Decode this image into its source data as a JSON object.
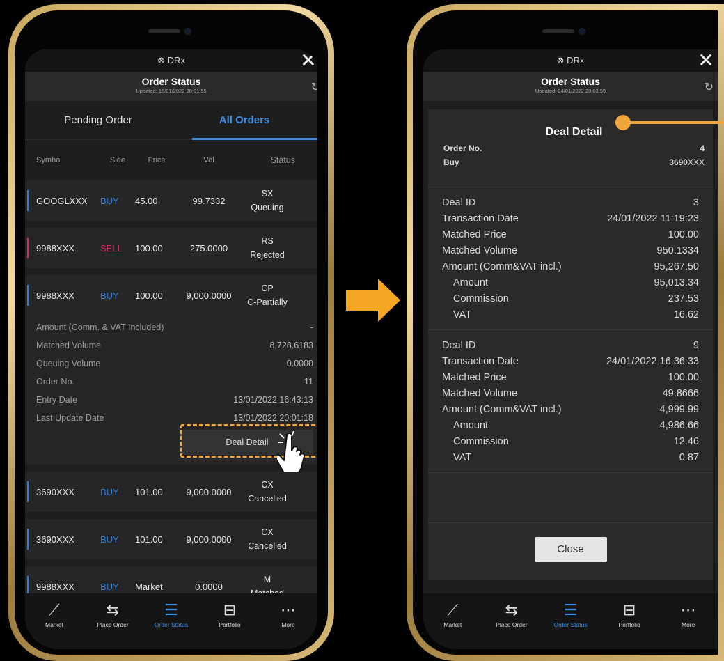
{
  "left": {
    "app_title": "DRx",
    "page_title": "Order Status",
    "updated": "Updated: 13/01/2022 20:01:55",
    "tabs": [
      "Pending Order",
      "All Orders"
    ],
    "columns": [
      "Symbol",
      "Side",
      "Price",
      "Vol",
      "Status"
    ],
    "rows": [
      {
        "symbol": "GOOGLXXX",
        "side": "BUY",
        "price": "45.00",
        "vol": "99.7332",
        "status_code": "SX",
        "status": "Queuing"
      },
      {
        "symbol": "9988XXX",
        "side": "SELL",
        "price": "100.00",
        "vol": "275.0000",
        "status_code": "RS",
        "status": "Rejected"
      },
      {
        "symbol": "9988XXX",
        "side": "BUY",
        "price": "100.00",
        "vol": "9,000.0000",
        "status_code": "CP",
        "status": "C-Partially"
      }
    ],
    "details": [
      {
        "k": "Amount (Comm. & VAT Included)",
        "v": "-"
      },
      {
        "k": "Matched Volume",
        "v": "8,728.6183"
      },
      {
        "k": "Queuing Volume",
        "v": "0.0000"
      },
      {
        "k": "Order No.",
        "v": "11"
      },
      {
        "k": "Entry Date",
        "v": "13/01/2022 16:43:13"
      },
      {
        "k": "Last Update Date",
        "v": "13/01/2022 20:01:18"
      }
    ],
    "deal_detail_btn": "Deal Detail",
    "rows2": [
      {
        "symbol": "3690XXX",
        "side": "BUY",
        "price": "101.00",
        "vol": "9,000.0000",
        "status_code": "CX",
        "status": "Cancelled"
      },
      {
        "symbol": "3690XXX",
        "side": "BUY",
        "price": "101.00",
        "vol": "9,000.0000",
        "status_code": "CX",
        "status": "Cancelled"
      },
      {
        "symbol": "9988XXX",
        "side": "BUY",
        "price": "Market",
        "vol": "0.0000",
        "status_code": "M",
        "status": "Matched"
      }
    ],
    "partial_row_code": "M",
    "nav": [
      "Market",
      "Place Order",
      "Order Status",
      "Portfolio",
      "More"
    ]
  },
  "right": {
    "app_title": "DRx",
    "page_title": "Order Status",
    "updated": "Updated: 24/01/2022 20:03:59",
    "modal_title": "Deal Detail",
    "order_no_label": "Order No.",
    "order_no": "4",
    "side": "Buy",
    "symbol_bold": "3690",
    "symbol_suffix": "XXX",
    "deals": [
      {
        "deal_id": "3",
        "transaction_date": "24/01/2022 11:19:23",
        "matched_price": "100.00",
        "matched_volume": "950.1334",
        "amount_incl": "95,267.50",
        "amount": "95,013.34",
        "commission": "237.53",
        "vat": "16.62"
      },
      {
        "deal_id": "9",
        "transaction_date": "24/01/2022 16:36:33",
        "matched_price": "100.00",
        "matched_volume": "49.8666",
        "amount_incl": "4,999.99",
        "amount": "4,986.66",
        "commission": "12.46",
        "vat": "0.87"
      }
    ],
    "labels": {
      "deal_id": "Deal ID",
      "transaction_date": "Transaction Date",
      "matched_price": "Matched Price",
      "matched_volume": "Matched Volume",
      "amount_incl": "Amount (Comm&VAT incl.)",
      "amount": "Amount",
      "commission": "Commission",
      "vat": "VAT"
    },
    "close_btn": "Close",
    "nav": [
      "Market",
      "Place Order",
      "Order Status",
      "Portfolio",
      "More"
    ]
  },
  "colors": {
    "accent": "#3d8fe6",
    "buy": "#2f7fd6",
    "sell": "#d12a66",
    "highlight": "#f0a63a",
    "bar_blue": "#2f7fd6",
    "bar_pink": "#d12a66"
  }
}
